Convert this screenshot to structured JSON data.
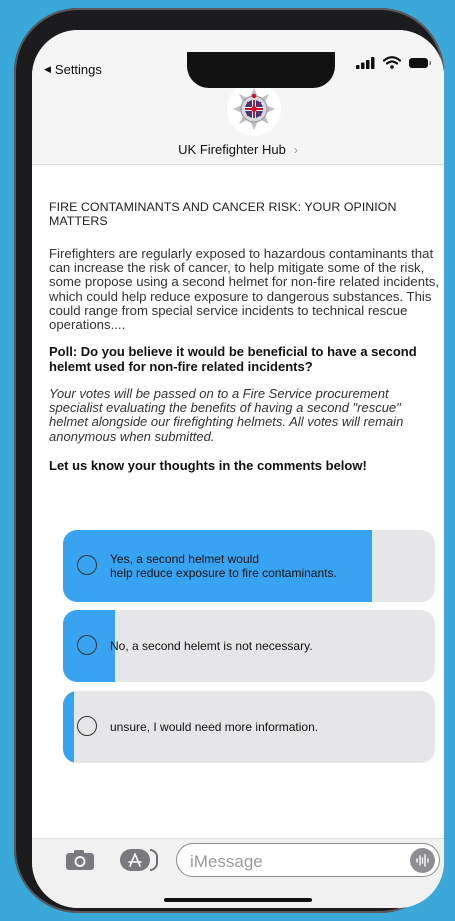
{
  "header": {
    "back_label": "Settings",
    "contact_name": "UK Firefighter Hub",
    "chevron": "›"
  },
  "post": {
    "title": "FIRE CONTAMINANTS AND CANCER RISK: YOUR OPINION MATTERS",
    "body": "Firefighters are regularly exposed to hazardous contaminants that can increase the risk of cancer, to help mitigate some of the risk, some propose using a second helmet for non-fire related incidents, which could help reduce exposure to dangerous substances. This could range from special service incidents to technical rescue operations....",
    "question": "Poll: Do you believe it would be beneficial to have a second helemt used for non-fire related incidents?",
    "note": "Your votes will be passed on to a Fire Service procurement specialist evaluating the benefits of having a second \"rescue\" helmet alongside our firefighting helmets. All votes will remain anonymous when submitted.",
    "cta": "Let us know your thoughts in the comments below!"
  },
  "poll": {
    "options": [
      {
        "label": "Yes, a second helmet would\nhelp reduce exposure to fire contaminants.",
        "share": 0.83
      },
      {
        "label": "No, a second helemt is not necessary.",
        "share": 0.14
      },
      {
        "label": "unsure, I would need more information.",
        "share": 0.03
      }
    ],
    "fill_color": "#38a3f1",
    "track_color": "#e6e6e8"
  },
  "composer": {
    "placeholder": "iMessage"
  },
  "icons": {
    "back": "back-triangle-icon",
    "signal": "signal-bars-icon",
    "wifi": "wifi-icon",
    "battery": "battery-icon",
    "avatar": "fire-service-crest-icon",
    "camera": "camera-icon",
    "apps": "app-store-icon",
    "voice": "voice-waveform-icon"
  }
}
